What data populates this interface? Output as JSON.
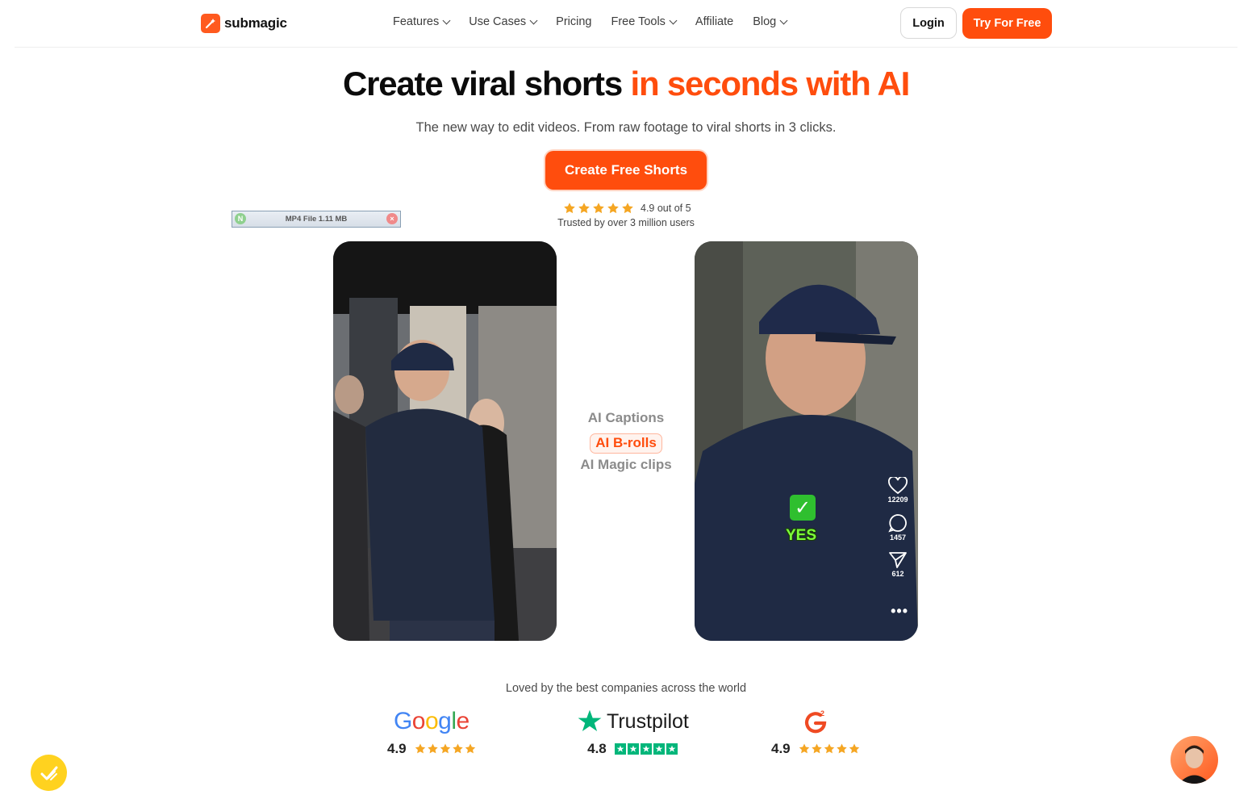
{
  "nav": {
    "brand": "submagic",
    "items": [
      {
        "label": "Features",
        "dropdown": true
      },
      {
        "label": "Use Cases",
        "dropdown": true
      },
      {
        "label": "Pricing",
        "dropdown": false
      },
      {
        "label": "Free Tools",
        "dropdown": true
      },
      {
        "label": "Affiliate",
        "dropdown": false
      },
      {
        "label": "Blog",
        "dropdown": true
      }
    ],
    "login_label": "Login",
    "try_label": "Try For Free"
  },
  "hero": {
    "title_main": "Create viral shorts",
    "title_accent": "in seconds with AI",
    "subtitle": "The new way to edit videos. From raw footage to viral shorts in 3 clicks.",
    "cta_label": "Create Free Shorts",
    "rating_text": "4.9 out of 5",
    "rating_value": 4.9,
    "trusted_text": "Trusted by over 3 million users"
  },
  "file_chip": {
    "label": "MP4 File 1.11 MB"
  },
  "features": [
    "AI Captions",
    "AI B-rolls",
    "AI Magic clips"
  ],
  "active_feature_index": 1,
  "right_video": {
    "likes": "12209",
    "comments": "1457",
    "shares": "612",
    "caption_word": "YES"
  },
  "social_proof": {
    "heading": "Loved by the best companies across the world",
    "brands": [
      {
        "name": "Google",
        "score": "4.9"
      },
      {
        "name": "Trustpilot",
        "score": "4.8"
      },
      {
        "name": "G2",
        "score": "4.9"
      }
    ]
  },
  "colors": {
    "accent": "#ff4d0d",
    "star": "#f5a623",
    "trustpilot": "#00b67a"
  }
}
